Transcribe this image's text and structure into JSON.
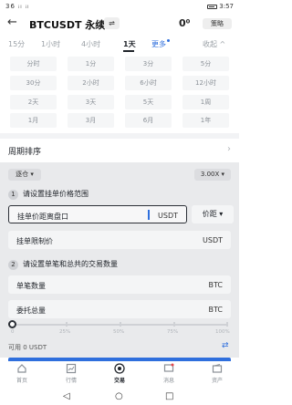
{
  "status_bar": {
    "signal": "36 ᵢₗ ᵢₗ",
    "battery_time": "3:57"
  },
  "header": {
    "symbol": "BTCUSDT 永续",
    "swap_icon": "⇌",
    "strategy": "策略"
  },
  "tabs": [
    {
      "label": "15分"
    },
    {
      "label": "1小时"
    },
    {
      "label": "4小时"
    },
    {
      "label": "1天"
    },
    {
      "label": "更多"
    },
    {
      "label": "收起"
    }
  ],
  "periods": [
    [
      "分时",
      "1分",
      "3分",
      "5分"
    ],
    [
      "30分",
      "2小时",
      "6小时",
      "12小时"
    ],
    [
      "2天",
      "3天",
      "5天",
      "1周"
    ],
    [
      "1月",
      "3月",
      "6月",
      "1年"
    ]
  ],
  "period_sort": "周期排序",
  "trade": {
    "margin_mode": "逐仓",
    "leverage": "3.00X",
    "step1_num": "1",
    "step1_title": "请设置挂单价格范围",
    "distance_label": "挂单价距离盘口",
    "distance_unit": "USDT",
    "spread_label": "价距",
    "limit_label": "挂单限制价",
    "limit_unit": "USDT",
    "step2_num": "2",
    "step2_title": "请设置单笔和总共的交易数量",
    "single_label": "单笔数量",
    "single_unit": "BTC",
    "total_label": "委托总量",
    "total_unit": "BTC",
    "slider_ticks": [
      "0",
      "25%",
      "50%",
      "75%",
      "100%"
    ],
    "slider_value": 0,
    "available": "可用 0 USDT"
  },
  "nav": [
    {
      "label": "首页"
    },
    {
      "label": "行情"
    },
    {
      "label": "交易"
    },
    {
      "label": "消息"
    },
    {
      "label": "资产"
    }
  ],
  "colors": {
    "accent": "#2f6fdd",
    "panel": "#e9eaec"
  }
}
